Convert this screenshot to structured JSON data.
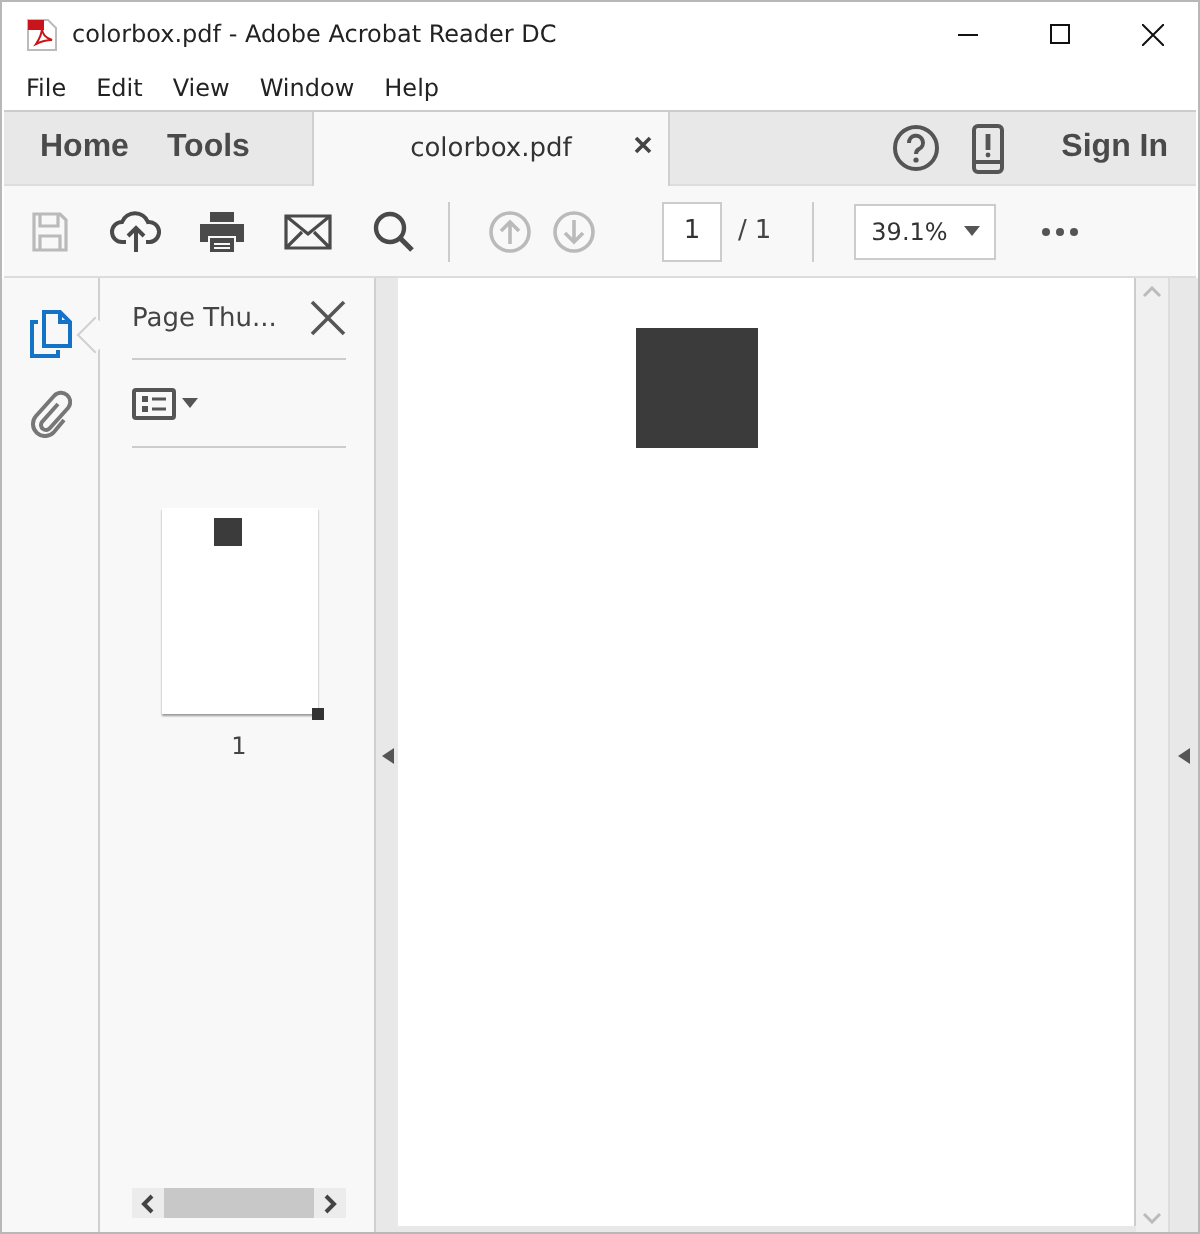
{
  "window": {
    "title": "colorbox.pdf - Adobe Acrobat Reader DC"
  },
  "menu": [
    "File",
    "Edit",
    "View",
    "Window",
    "Help"
  ],
  "nav": [
    {
      "label": "Home",
      "kind": "nav",
      "selected": false
    },
    {
      "label": "Tools",
      "kind": "nav",
      "selected": false
    },
    {
      "label": "colorbox.pdf",
      "kind": "document",
      "selected": true
    }
  ],
  "sign_in": "Sign In",
  "toolbar": [
    {
      "kind": "save",
      "disabled": true
    },
    {
      "kind": "upload",
      "disabled": false
    },
    {
      "kind": "print",
      "disabled": false
    },
    {
      "kind": "mail",
      "disabled": false
    },
    {
      "kind": "search",
      "disabled": false
    },
    {
      "kind": "prev",
      "disabled": true
    },
    {
      "kind": "next",
      "disabled": true
    }
  ],
  "page": {
    "value": "1",
    "separator": "/",
    "total": "1"
  },
  "zoom": {
    "value": "39.1%"
  },
  "rail": [
    {
      "kind": "pages",
      "selected": true
    },
    {
      "kind": "attachments",
      "selected": false
    }
  ],
  "panel": {
    "title": "Page Thu...",
    "thumbnails": [
      {
        "label": "1"
      }
    ]
  }
}
